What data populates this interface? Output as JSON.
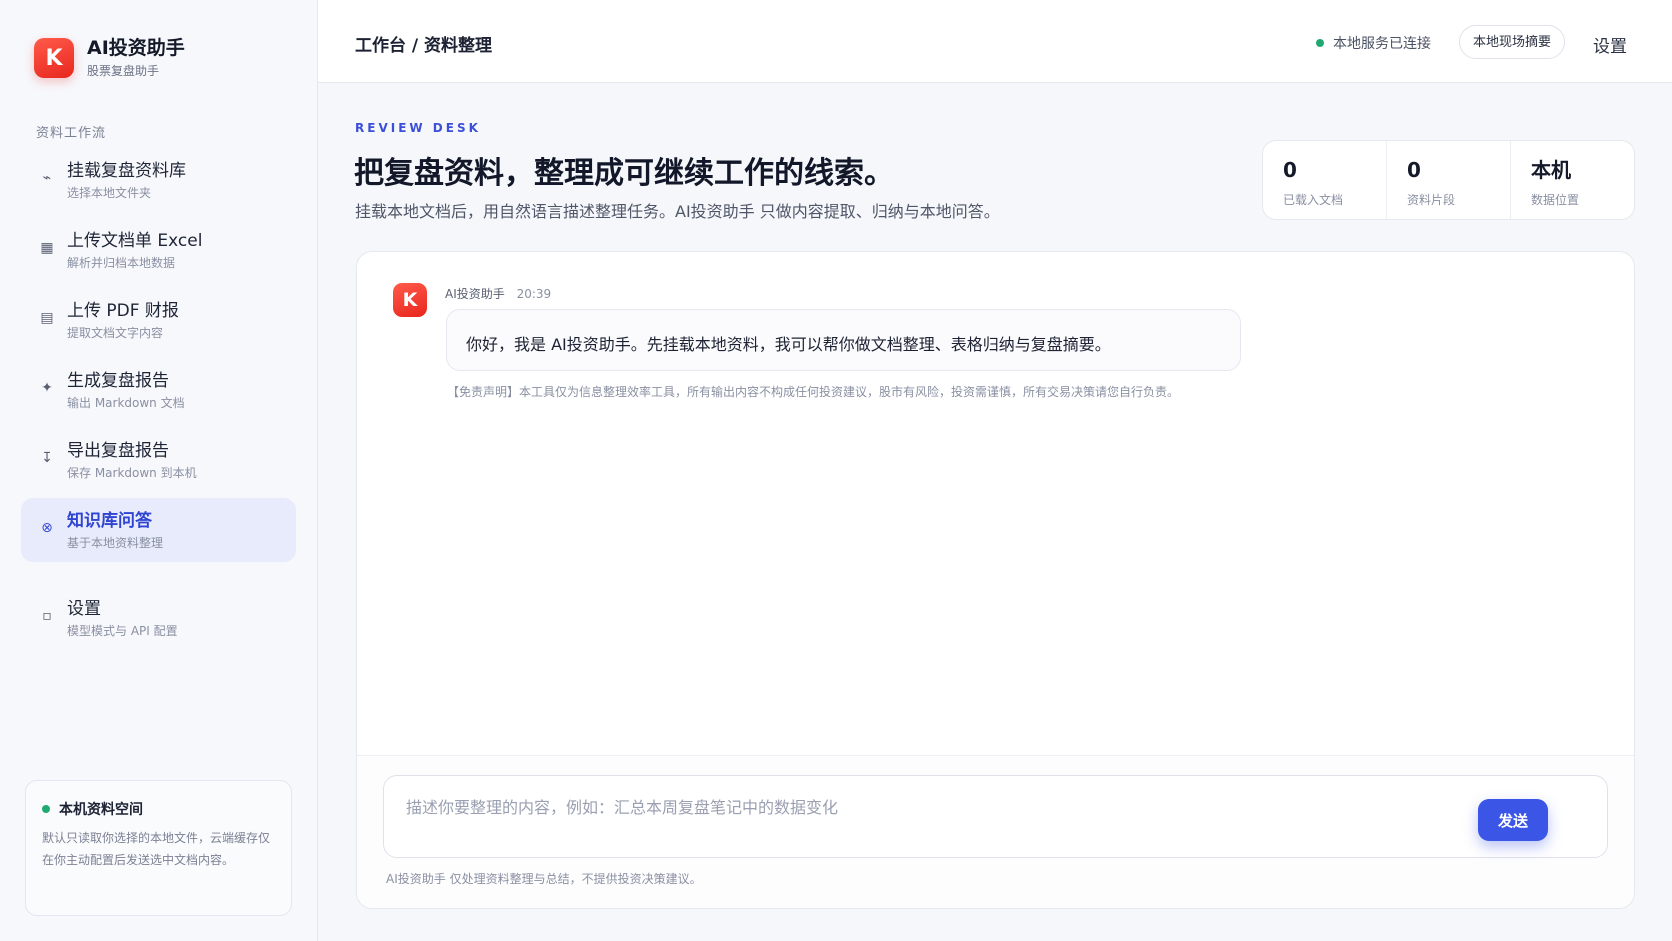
{
  "brand": {
    "logo_letter": "K",
    "title": "AI投资助手",
    "subtitle": "股票复盘助手"
  },
  "sidebar": {
    "section_label": "资料工作流",
    "items": [
      {
        "icon": "mount-icon",
        "glyph": "⌁",
        "title": "挂载复盘资料库",
        "subtitle": "选择本地文件夹",
        "active": false
      },
      {
        "icon": "table-icon",
        "glyph": "▦",
        "title": "上传文档单 Excel",
        "subtitle": "解析并归档本地数据",
        "active": false
      },
      {
        "icon": "document-icon",
        "glyph": "▤",
        "title": "上传 PDF 财报",
        "subtitle": "提取文档文字内容",
        "active": false
      },
      {
        "icon": "sparkle-icon",
        "glyph": "✦",
        "title": "生成复盘报告",
        "subtitle": "输出 Markdown 文档",
        "active": false
      },
      {
        "icon": "download-icon",
        "glyph": "↧",
        "title": "导出复盘报告",
        "subtitle": "保存 Markdown 到本机",
        "active": false
      },
      {
        "icon": "knowledge-icon",
        "glyph": "⊗",
        "title": "知识库问答",
        "subtitle": "基于本地资料整理",
        "active": true
      }
    ],
    "settings": {
      "icon": "settings-icon",
      "glyph": "▫",
      "title": "设置",
      "subtitle": "模型模式与 API 配置"
    },
    "local_card": {
      "title": "本机资料空间",
      "description": "默认只读取你选择的本地文件，云端缓存仅在你主动配置后发送选中文档内容。"
    }
  },
  "topbar": {
    "breadcrumb": "工作台 / 资料整理",
    "status_text": "本地服务已连接",
    "summary_button": "本地现场摘要",
    "settings_link": "设置"
  },
  "hero": {
    "eyebrow": "REVIEW DESK",
    "title": "把复盘资料，整理成可继续工作的线索。",
    "description": "挂载本地文档后，用自然语言描述整理任务。AI投资助手 只做内容提取、归纳与本地问答。"
  },
  "stats": [
    {
      "value": "0",
      "label": "已载入文档"
    },
    {
      "value": "0",
      "label": "资料片段"
    },
    {
      "value": "本机",
      "label": "数据位置"
    }
  ],
  "chat": {
    "messages": [
      {
        "avatar_letter": "K",
        "sender": "AI投资助手",
        "time": "20:39",
        "text": "你好，我是 AI投资助手。先挂载本地资料，我可以帮你做文档整理、表格归纳与复盘摘要。",
        "disclaimer": "【免责声明】本工具仅为信息整理效率工具，所有输出内容不构成任何投资建议，股市有风险，投资需谨慎，所有交易决策请您自行负责。"
      }
    ],
    "composer": {
      "placeholder": "描述你要整理的内容，例如：汇总本周复盘笔记中的数据变化",
      "value": "",
      "send_label": "发送",
      "note": "AI投资助手 仅处理资料整理与总结，不提供投资决策建议。"
    }
  },
  "colors": {
    "accent": "#3b55e6",
    "brand_red": "#e8261e",
    "status_green": "#1fa971"
  }
}
